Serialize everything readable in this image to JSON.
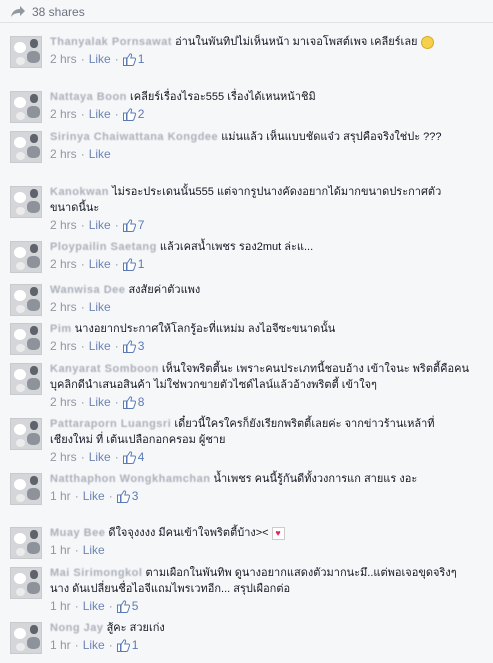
{
  "shares": {
    "label": "38 shares"
  },
  "comments": [
    {
      "name": "Thanyalak Pornsawat",
      "text": "อ่านในพันทิปไม่เห็นหน้า มาเจอโพสต์เพจ เคลียร์เลย",
      "emoji": "smile-emoji",
      "time": "2 hrs",
      "like": "Like",
      "count": "1"
    },
    {
      "name": "Nattaya Boon",
      "text": "เคลียร์เรื่องไรอะ555 เรื่องได้เหนหน้าชิมิ",
      "time": "2 hrs",
      "like": "Like",
      "count": "2"
    },
    {
      "name": "Sirinya Chaiwattana Kongdee",
      "text": "แม่นแล้ว เห็นแบบชัดแจ๋ว สรุปคือจริงใช่ปะ ???",
      "time": "2 hrs",
      "like": "Like",
      "count": ""
    },
    {
      "name": "Kanokwan",
      "text": "ไม่รอะประเดนนั้น555 แต่จากรูปนางคัดงอยากได้มากขนาดประกาศตัว ขนาดนี้นะ",
      "time": "2 hrs",
      "like": "Like",
      "count": "7"
    },
    {
      "name": "Ploypailin Saetang",
      "text": "แล้วเคสน้ำเพชร รอง2mut ล่ะแ...",
      "time": "2 hrs",
      "like": "Like",
      "count": "1"
    },
    {
      "name": "Wanwisa Dee",
      "text": "สงสัยค่าตัวแพง",
      "time": "2 hrs",
      "like": "Like",
      "count": ""
    },
    {
      "name": "Pim",
      "text": "นางอยากประกาศให้โลกรู้อะที่แหม่ม ลงไอจีซะขนาดนั้น",
      "time": "2 hrs",
      "like": "Like",
      "count": "3"
    },
    {
      "name": "Kanyarat Somboon",
      "text": "เห็นใจพริตตี้นะ เพราะคนประเภทนี้ชอบอ้าง เข้าใจนะ พริตตี้คือคน บุคลิกดีนำเสนอสินค้า ไม่ใช่พวกขายตัวไซด์ไลน์แล้วอ้างพริตตี้ เข้าใจๆ",
      "time": "2 hrs",
      "like": "Like",
      "count": "8"
    },
    {
      "name": "Pattaraporn Luangsri",
      "text": "เดี๋ยวนี้ใครใครก็ยังเรียกพริตตี้เลยค่ะ จากข่าวร้านเหล้าที่เชียงใหม่ ที่ เต้นเปลือกอกครอม ผู้ชาย",
      "time": "2 hrs",
      "like": "Like",
      "count": "4"
    },
    {
      "name": "Natthaphon Wongkhamchan",
      "text": "น้ำเพชร คนนี้รู้กันดีทั้งวงการแก สายแร งอะ",
      "time": "1 hr",
      "like": "Like",
      "count": "3"
    },
    {
      "name": "Muay Bee",
      "text": "ดีใจจุงงงง มีคนเข้าใจพริตตี้บ้าง><",
      "emoji": "heart-emoji",
      "time": "1 hr",
      "like": "Like",
      "count": ""
    },
    {
      "name": "Mai Sirimongkol",
      "text": "ตามเผือกในพันทิพ ดูนางอยากแสดงตัวมากนะมึ..แต่พอเจอขุดจริงๆนาง ดันเปลี่ยนชื่อไอจีแถมไพรเวทอีก... สรุปเผือกต่อ",
      "time": "1 hr",
      "like": "Like",
      "count": "5"
    },
    {
      "name": "Nong Jay",
      "text": "สู้คะ สวยเก่ง",
      "time": "1 hr",
      "like": "Like",
      "count": "1"
    }
  ]
}
